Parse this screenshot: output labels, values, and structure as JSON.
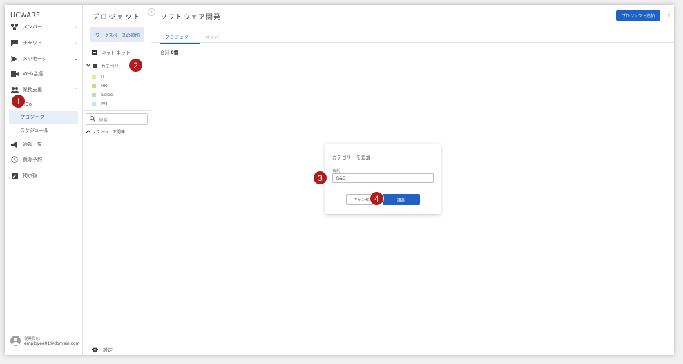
{
  "app": {
    "brand": "UCWARE"
  },
  "nav": {
    "items": [
      {
        "label": "メンバー",
        "icon": "org-chart-icon",
        "chev": "⌄"
      },
      {
        "label": "チャット",
        "icon": "chat-icon",
        "chev": "⌄"
      },
      {
        "label": "メッセージ",
        "icon": "send-icon",
        "chev": "⌄"
      },
      {
        "label": "Web会議",
        "icon": "video-icon"
      },
      {
        "label": "業務支援",
        "icon": "people-icon",
        "chev": "⌃"
      }
    ],
    "sub_items": [
      {
        "label": "ToDo"
      },
      {
        "label": "プロジェクト",
        "active": true
      },
      {
        "label": "スケジュール"
      }
    ],
    "bottom_items": [
      {
        "label": "通知一覧",
        "icon": "megaphone-icon"
      },
      {
        "label": "資源予約",
        "icon": "clock-icon"
      },
      {
        "label": "掲示板",
        "icon": "board-icon"
      }
    ],
    "user": {
      "name": "従業員01",
      "email": "employee01@domain.com"
    }
  },
  "middle": {
    "title": "プロジェクト",
    "collapse_glyph": "‹",
    "workspace_button": "ワークスペースの追加",
    "cabinet": "キャビネット",
    "category_header": "カテゴリー",
    "categories": [
      {
        "label": "IT",
        "color": "#f2e58a"
      },
      {
        "label": "HR",
        "color": "#c5dc7a"
      },
      {
        "label": "Sales",
        "color": "#b7e3a8"
      },
      {
        "label": "PM",
        "color": "#bfe6f2"
      }
    ],
    "search_placeholder": "検索",
    "tree_item": "ソフトウェア開発",
    "settings": "設定"
  },
  "main": {
    "title": "ソフトウェア開発",
    "add_project_button": "プロジェクト追加",
    "tabs": [
      {
        "label": "プロジェクト",
        "active": true
      },
      {
        "label": "メンバー"
      }
    ],
    "total_label": "合計",
    "total_value": "0個"
  },
  "dialog": {
    "title": "カテゴリーを追加",
    "name_label": "名前",
    "name_value": "R&D",
    "cancel_button": "キャンセル",
    "confirm_button": "確認"
  },
  "markers": [
    "1",
    "2",
    "3",
    "4"
  ]
}
